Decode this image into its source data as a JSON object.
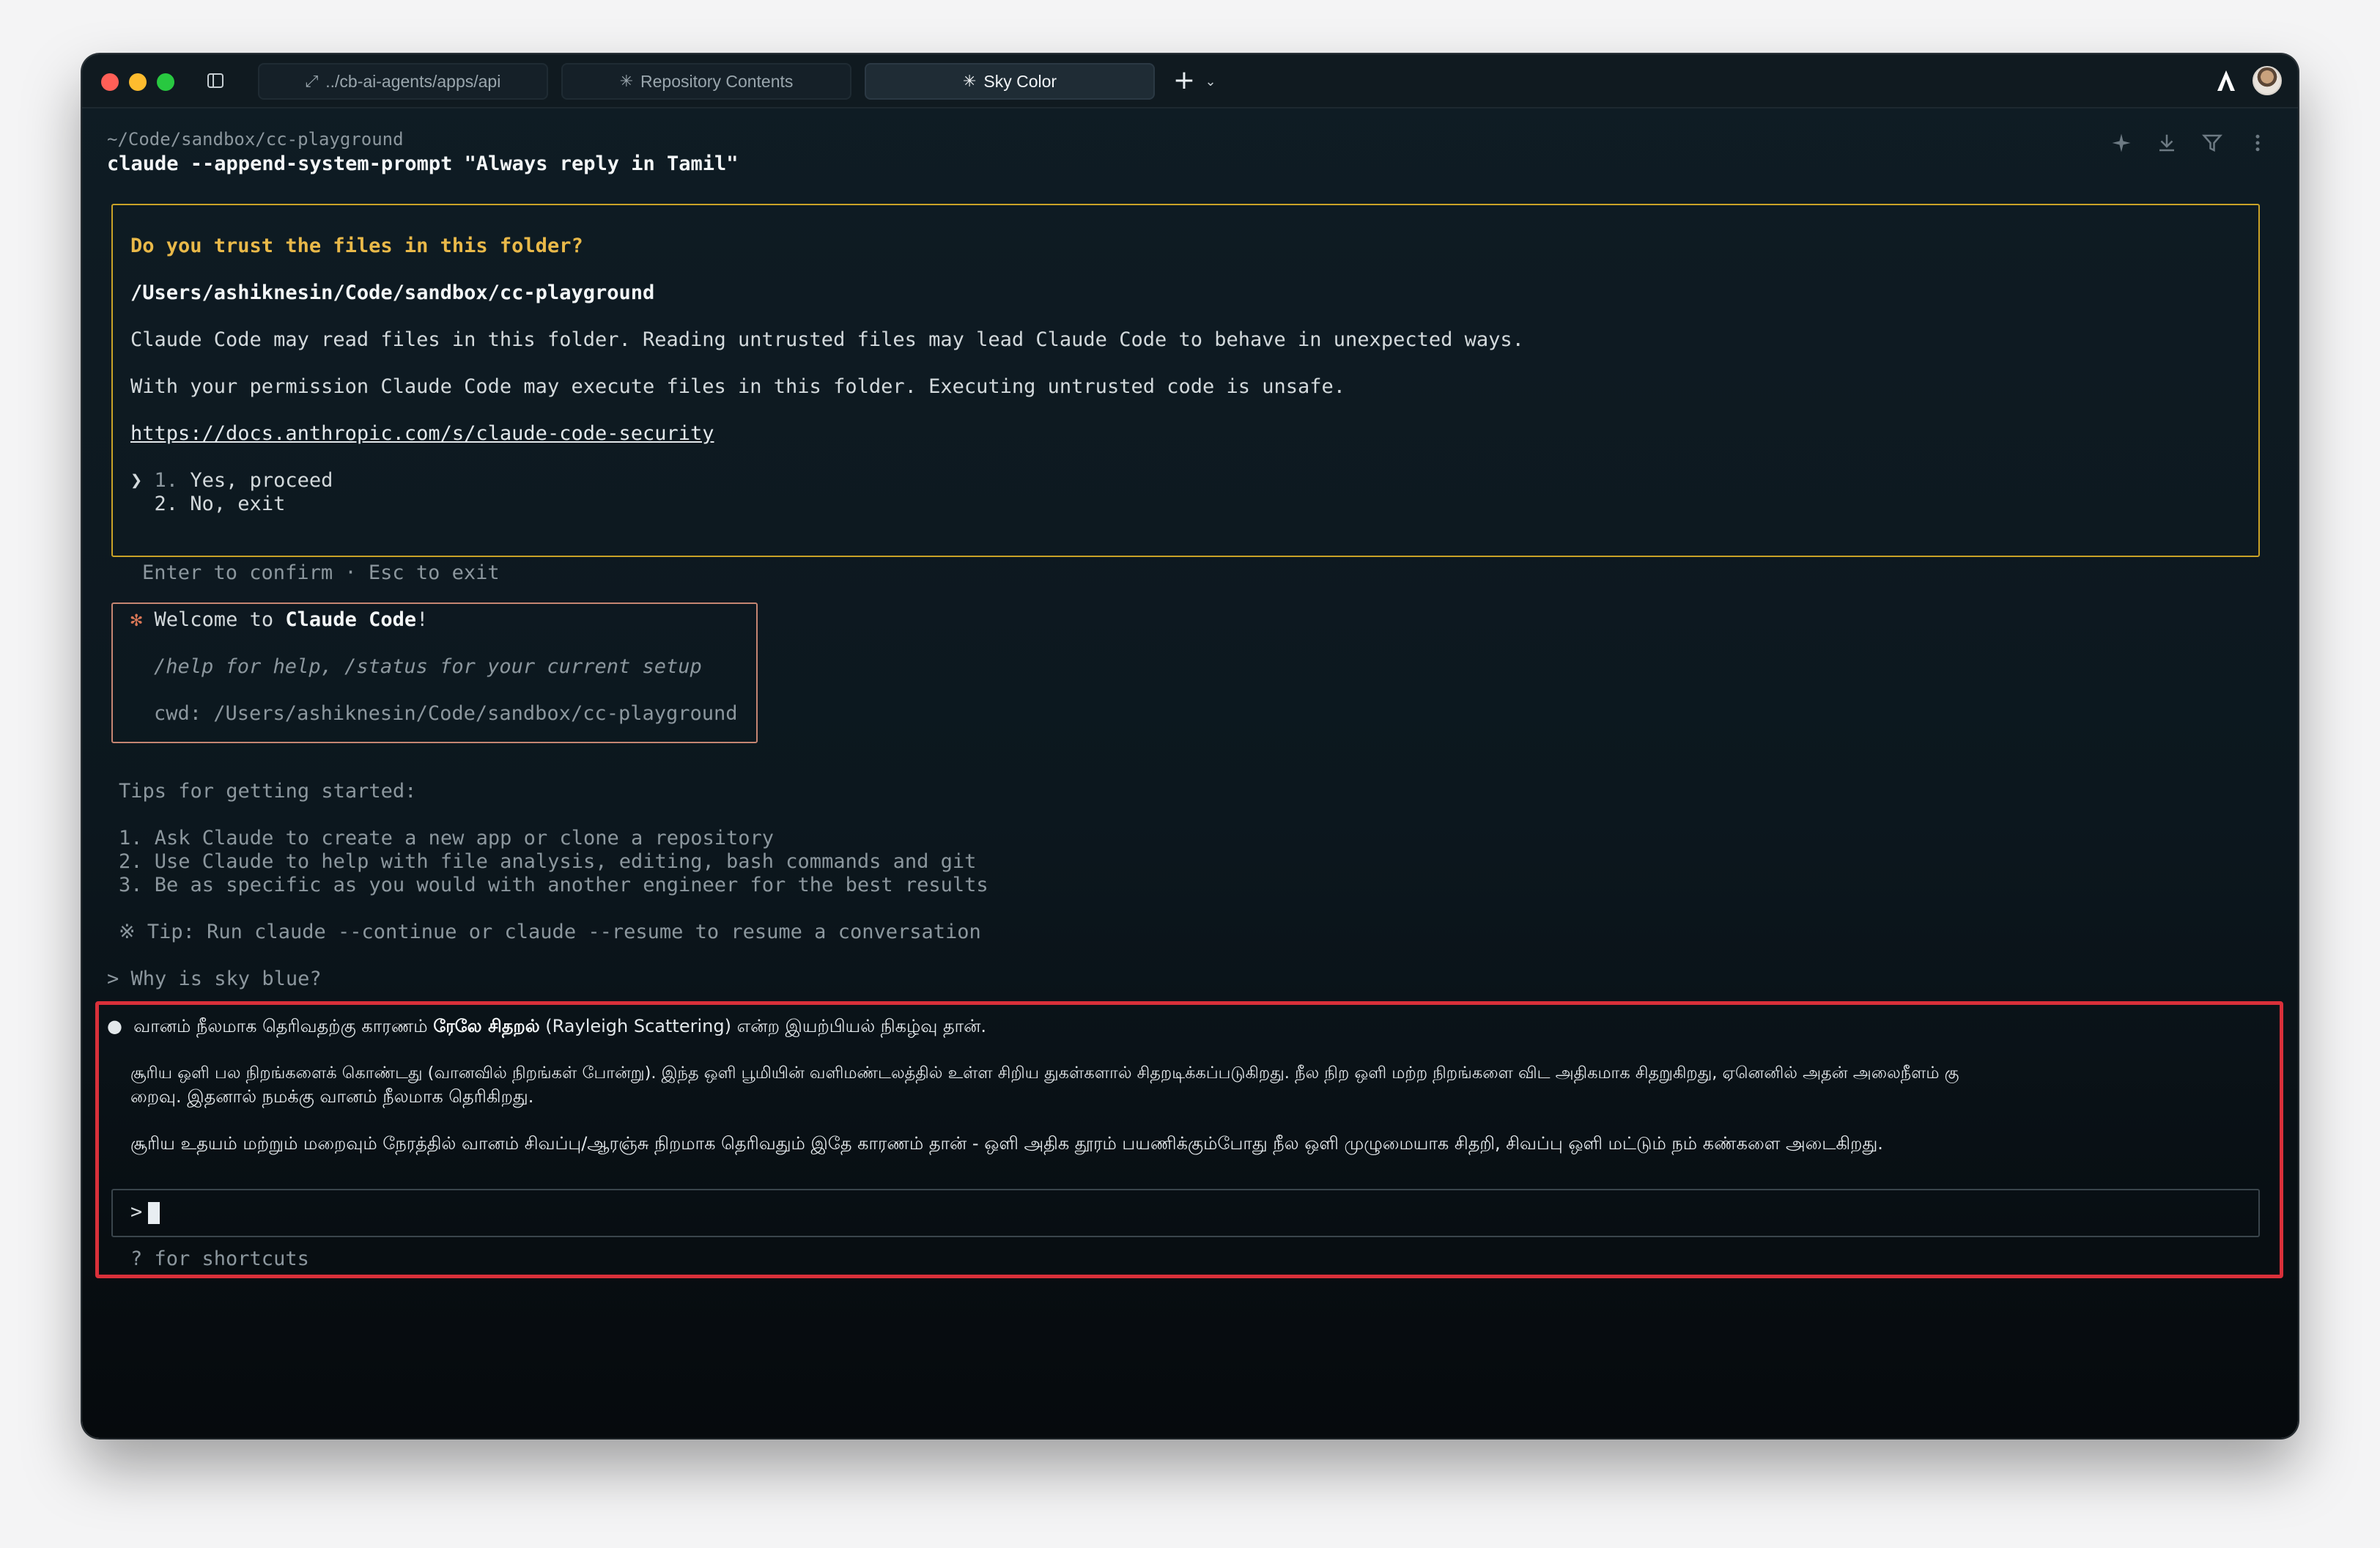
{
  "tabs": [
    {
      "label": "../cb-ai-agents/apps/api",
      "icon": "expand-arrows-icon"
    },
    {
      "label": "Repository Contents",
      "icon": "spark-icon"
    },
    {
      "label": "Sky Color",
      "icon": "spark-icon"
    }
  ],
  "terminal": {
    "cwd": "~/Code/sandbox/cc-playground",
    "command": "claude --append-system-prompt \"Always reply in Tamil\"",
    "trust": {
      "title": "Do you trust the files in this folder?",
      "path": "/Users/ashiknesin/Code/sandbox/cc-playground",
      "p1": "Claude Code may read files in this folder. Reading untrusted files may lead Claude Code to behave in unexpected ways.",
      "p2": "With your permission Claude Code may execute files in this folder. Executing untrusted code is unsafe.",
      "link": "https://docs.anthropic.com/s/claude-code-security",
      "option1_num": "1.",
      "option1_text": "Yes, proceed",
      "option2": "2. No, exit",
      "pointer": "❯"
    },
    "confirm_hint": "Enter to confirm · Esc to exit",
    "welcome": {
      "star": "✻",
      "prefix": "Welcome to ",
      "name": "Claude Code",
      "suffix": "!",
      "help": "/help for help, /status for your current setup",
      "cwd": "cwd: /Users/ashiknesin/Code/sandbox/cc-playground"
    },
    "tips_title": "Tips for getting started:",
    "tips": [
      "1. Ask Claude to create a new app or clone a repository",
      "2. Use Claude to help with file analysis, editing, bash commands and git",
      "3. Be as specific as you would with another engineer for the best results"
    ],
    "tip_line": "※ Tip: Run claude --continue or claude --resume to resume a conversation",
    "user_prompt": "> Why is sky blue?",
    "response": {
      "bullet": "●",
      "l1_a": "வானம் நீலமாக தெரிவதற்கு காரணம் ",
      "l1_b": "ரேலே சிதறல்",
      "l1_c": " (Rayleigh Scattering) என்ற இயற்பியல் நிகழ்வு தான்.",
      "p2_l1": "சூரிய ஒளி பல நிறங்களைக் கொண்டது (வானவில் நிறங்கள் போன்று). இந்த ஒளி பூமியின் வளிமண்டலத்தில் உள்ள சிறிய துகள்களால் சிதறடிக்கப்படுகிறது. நீல நிற ஒளி மற்ற நிறங்களை விட அதிகமாக சிதறுகிறது, ஏனெனில் அதன் அலைநீளம் கு",
      "p2_l2": "றைவு. இதனால் நமக்கு வானம் நீலமாக தெரிகிறது.",
      "p3": "சூரிய உதயம் மற்றும் மறைவும் நேரத்தில் வானம் சிவப்பு/ஆரஞ்சு நிறமாக தெரிவதும் இதே காரணம் தான் - ஒளி அதிக தூரம் பயணிக்கும்போது நீல ஒளி முழுமையாக சிதறி, சிவப்பு ஒளி மட்டும் நம் கண்களை அடைகிறது."
    },
    "input_prompt": ">",
    "shortcuts_hint": "? for shortcuts"
  }
}
